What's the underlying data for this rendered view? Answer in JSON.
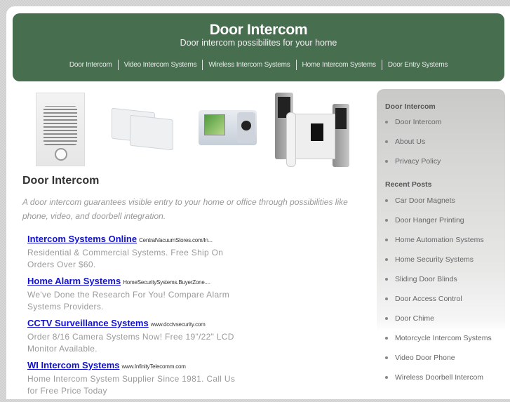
{
  "header": {
    "title": "Door Intercom",
    "tagline": "Door intercom possibilites for your home",
    "nav": [
      {
        "label": "Door Intercom"
      },
      {
        "label": "Video Intercom Systems"
      },
      {
        "label": "Wireless Intercom Systems"
      },
      {
        "label": "Home Intercom Systems"
      },
      {
        "label": "Door Entry Systems"
      }
    ]
  },
  "products": [
    {
      "icon": "door-speaker-image"
    },
    {
      "icon": "wired-intercom-units-image"
    },
    {
      "icon": "video-intercom-kit-image"
    },
    {
      "icon": "video-door-phone-set-image"
    }
  ],
  "main": {
    "title": "Door Intercom",
    "intro": "A door intercom guarantees visible entry to your home or office through possibilities like phone, video, and doorbell integration.",
    "ads": [
      {
        "title": "Intercom Systems Online",
        "url": "CentralVacuumStores.com/In...",
        "description": "Residential & Commercial Systems. Free Ship On Orders Over $60."
      },
      {
        "title": "Home Alarm Systems",
        "url": "HomeSecuritySystems.BuyerZone....",
        "description": "We've Done the Research For You! Compare Alarm Systems Providers."
      },
      {
        "title": "CCTV Surveillance Systems",
        "url": "www.dcctvsecurity.com",
        "description": "Order 8/16 Camera Systems Now! Free 19\"/22\" LCD Monitor Available."
      },
      {
        "title": "WI Intercom Systems",
        "url": "www.InfinityTelecomm.com",
        "description": "Home Intercom System Supplier Since 1981. Call Us for Free Price Today"
      }
    ]
  },
  "sidebar": {
    "pages": {
      "title": "Door Intercom",
      "items": [
        {
          "label": "Door Intercom"
        },
        {
          "label": "About Us"
        },
        {
          "label": "Privacy Policy"
        }
      ]
    },
    "recent": {
      "title": "Recent Posts",
      "items": [
        {
          "label": "Car Door Magnets"
        },
        {
          "label": "Door Hanger Printing"
        },
        {
          "label": "Home Automation Systems"
        },
        {
          "label": "Home Security Systems"
        },
        {
          "label": "Sliding Door Blinds"
        },
        {
          "label": "Door Access Control"
        },
        {
          "label": "Door Chime"
        },
        {
          "label": "Motorcycle Intercom Systems"
        },
        {
          "label": "Video Door Phone"
        },
        {
          "label": "Wireless Doorbell Intercom"
        }
      ]
    }
  },
  "colors": {
    "header_bg": "#476f4f",
    "ad_link": "#1212cc",
    "sidebar_bg": "#d5d5d4"
  }
}
